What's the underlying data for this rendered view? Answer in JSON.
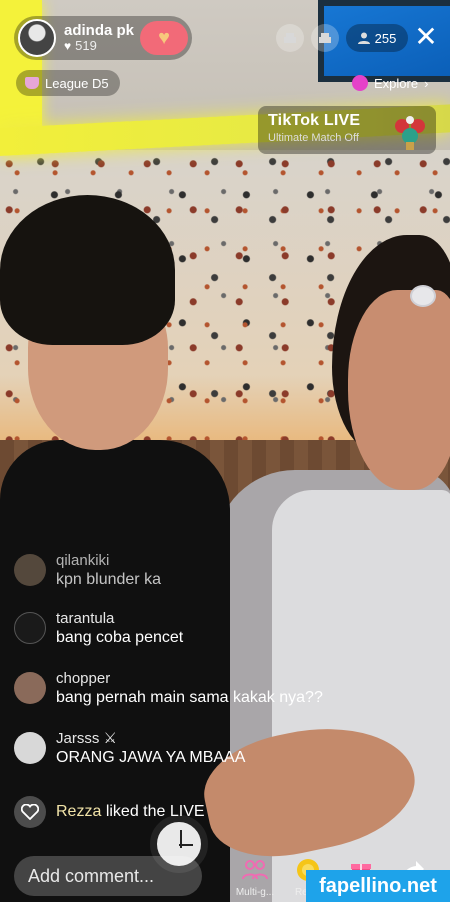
{
  "host": {
    "name": "adinda pk",
    "likes": "519"
  },
  "viewer_count": "255",
  "league": {
    "label": "League D5"
  },
  "explore": {
    "label": "Explore",
    "chevron": "›"
  },
  "banner": {
    "title": "TikTok LIVE",
    "subtitle": "Ultimate Match Off"
  },
  "comments": [
    {
      "user": "qilankiki",
      "message": "kpn blunder ka",
      "avatar_color": "#6b5b4b"
    },
    {
      "user": "tarantula",
      "message": "bang coba pencet",
      "avatar_color": "#1a1a1a"
    },
    {
      "user": "chopper",
      "message": "bang pernah main sama kakak nya??",
      "avatar_color": "#8a6a5a"
    },
    {
      "user": "Jarsss",
      "user_badge": "⚔",
      "message": "ORANG JAWA YA MBAAA",
      "avatar_color": "#d8d8d8"
    }
  ],
  "liked_event": {
    "user": "Rezza",
    "text": "liked the LIVE"
  },
  "input": {
    "placeholder": "Add comment..."
  },
  "bottom_actions": [
    {
      "label": "Multi-g...",
      "icon": "multi-guest-icon"
    },
    {
      "label": "Rec...",
      "icon": "recharge-icon"
    },
    {
      "label": "",
      "icon": "gift-icon"
    },
    {
      "label": "",
      "icon": "share-icon"
    }
  ],
  "watermark": "fapellino.net",
  "icons": {
    "close": "✕",
    "heart": "♥",
    "person": "👤"
  },
  "colors": {
    "follow": "#f26a78",
    "watermark": "#1ea3ea",
    "neon": "#f2ef3a"
  }
}
